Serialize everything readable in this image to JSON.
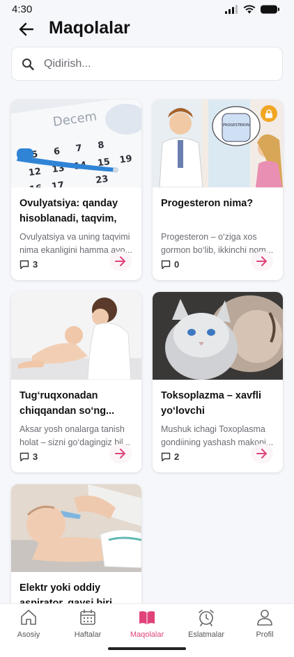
{
  "status_bar": {
    "time": "4:30"
  },
  "header": {
    "title": "Maqolalar"
  },
  "search": {
    "placeholder": "Qidirish..."
  },
  "articles": [
    {
      "title": "Ovulyatsiya: qanday\nhisoblanadi, taqvim, te...",
      "description": "Ovulyatsiya va uning taqvimi\nnima ekanligini hamma avo...",
      "comments": "3",
      "locked": false,
      "image": "calendar-thermometer"
    },
    {
      "title": "Progesteron nima?",
      "description": "Progesteron – o‘ziga xos\ngormon bo‘lib, ikkinchi nom...",
      "comments": "0",
      "locked": true,
      "image": "doctor-illustration",
      "image_text": "PROGESTERON"
    },
    {
      "title": "Tug‘ruqxonadan\nchiqqandan so‘ng...",
      "description": "Aksar yosh onalarga tanish\nholat – sizni go‘dagingiz bil...",
      "comments": "3",
      "locked": false,
      "image": "mother-and-baby"
    },
    {
      "title": "Toksoplazma – xavfli\nyo‘lovchi",
      "description": "Mushuk ichagi Toxoplasma\ngondiining yashash makoni...",
      "comments": "2",
      "locked": false,
      "image": "cat-and-woman"
    },
    {
      "title": "Elektr yoki oddiy\naspirator, qaysi biri yax...",
      "description": "",
      "comments": "",
      "locked": false,
      "image": "baby-aspirator"
    }
  ],
  "nav": {
    "items": [
      {
        "label": "Asosiy",
        "icon": "home-icon",
        "active": false
      },
      {
        "label": "Haftalar",
        "icon": "calendar-icon",
        "active": false
      },
      {
        "label": "Maqolalar",
        "icon": "book-icon",
        "active": true
      },
      {
        "label": "Eslatmalar",
        "icon": "alarm-clock-icon",
        "active": false
      },
      {
        "label": "Profil",
        "icon": "person-icon",
        "active": false
      }
    ]
  },
  "colors": {
    "accent": "#e0427a",
    "lock": "#f2a623",
    "background": "#f6f7fb"
  }
}
